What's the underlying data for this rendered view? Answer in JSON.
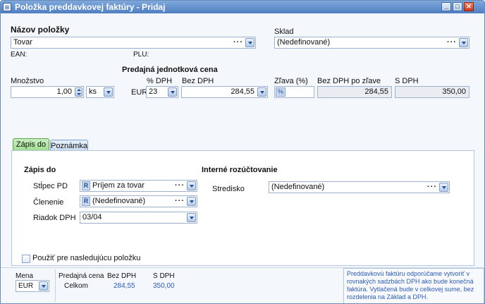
{
  "window": {
    "title": "Položka preddavkovej faktúry - Pridaj",
    "min_label": "_",
    "max_label": "□",
    "close_label": "✕"
  },
  "item": {
    "name_label": "Názov položky",
    "name_value": "Tovar",
    "ean_label": "EAN:",
    "plu_label": "PLU:",
    "warehouse_label": "Sklad",
    "warehouse_value": "(Nedefinované)"
  },
  "price": {
    "section_title": "Predajná jednotková cena",
    "quantity_label": "Množstvo",
    "quantity_value": "1,00",
    "unit_value": "ks",
    "currency": "EUR",
    "vat_pct_label": "% DPH",
    "vat_pct_value": "23",
    "net_label": "Bez DPH",
    "net_value": "284,55",
    "discount_label": "Zľava (%)",
    "discount_badge": "%",
    "discount_value": "",
    "net_after_discount_label": "Bez DPH po zľave",
    "net_after_discount_value": "284,55",
    "gross_label": "S DPH",
    "gross_value": "350,00"
  },
  "tabs": [
    {
      "label": "Zápis do",
      "active": true
    },
    {
      "label": "Poznámka",
      "active": false
    }
  ],
  "zapis": {
    "section_title": "Zápis do",
    "column_label": "Stĺpec PD",
    "column_badge": "R",
    "column_value": "Príjem za tovar",
    "breakdown_label": "Členenie",
    "breakdown_badge": "R",
    "breakdown_value": "(Nedefinované)",
    "vat_row_label": "Riadok DPH",
    "vat_row_value": "03/04"
  },
  "internal": {
    "section_title": "Interné rozúčtovanie",
    "center_label": "Stredisko",
    "center_value": "(Nedefinované)"
  },
  "reuse_checkbox_label": "Použiť pre nasledujúcu položku",
  "footer": {
    "currency_label": "Mena",
    "currency_value": "EUR",
    "price_label": "Predajná cena",
    "total_label": "Celkom",
    "net_header": "Bez DPH",
    "gross_header": "S DPH",
    "net_total": "284,55",
    "gross_total": "350,00",
    "info_text": "Preddavkovú faktúru odporúčame vytvoriť v rovnakých sadzbách DPH ako bude konečná faktúra. Vytlačená bude v celkovej sume, bez rozdelenia na Základ a DPH."
  },
  "colors": {
    "accent": "#4f7fc1",
    "active_tab": "#9fdb8e",
    "info_text": "#2b5cb8"
  },
  "icons": {
    "app": "document-icon",
    "dropdown": "chevron-down-icon",
    "more": "ellipsis-icon",
    "spinner": "spinner-icon"
  }
}
